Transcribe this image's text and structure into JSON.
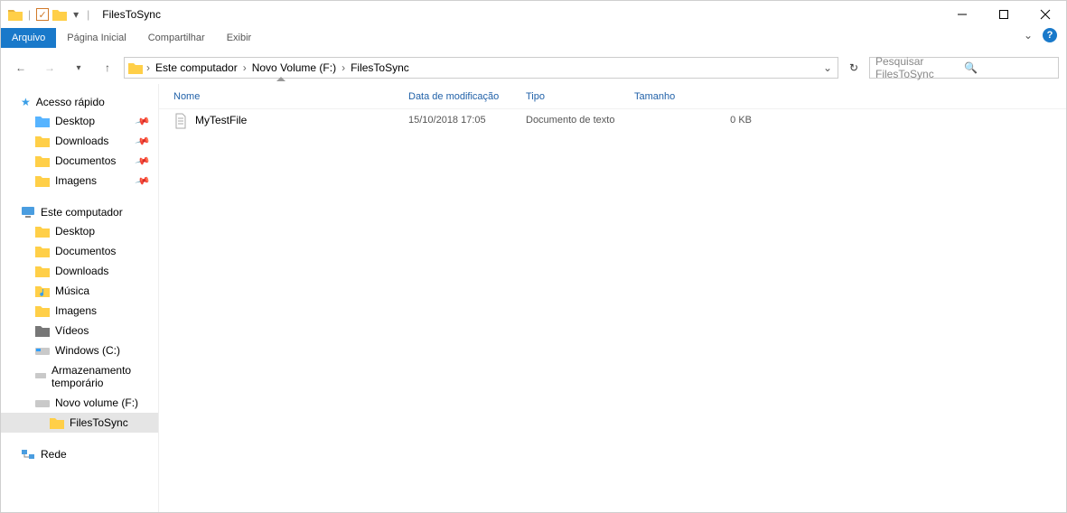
{
  "window": {
    "title": "FilesToSync"
  },
  "ribbon": {
    "file": "Arquivo",
    "home": "Página Inicial",
    "share": "Compartilhar",
    "view": "Exibir"
  },
  "breadcrumb": {
    "root": "Este computador",
    "drive": "Novo Volume (F:)",
    "folder": "FilesToSync"
  },
  "search": {
    "placeholder": "Pesquisar FilesToSync"
  },
  "columns": {
    "name": "Nome",
    "date": "Data de modificação",
    "type": "Tipo",
    "size": "Tamanho"
  },
  "files": [
    {
      "name": "MyTestFile",
      "date": "15/10/2018 17:05",
      "type": "Documento de texto",
      "size": "0 KB"
    }
  ],
  "sidebar": {
    "quick": "Acesso rápido",
    "desktop": "Desktop",
    "downloads": "Downloads",
    "documents": "Documentos",
    "images": "Imagens",
    "thispc": "Este computador",
    "music": "Música",
    "videos": "Vídeos",
    "windows_c": "Windows (C:)",
    "temp_storage": "Armazenamento temporário",
    "new_volume": "Novo volume (F:)",
    "files_to_sync": "FilesToSync",
    "network": "Rede"
  }
}
